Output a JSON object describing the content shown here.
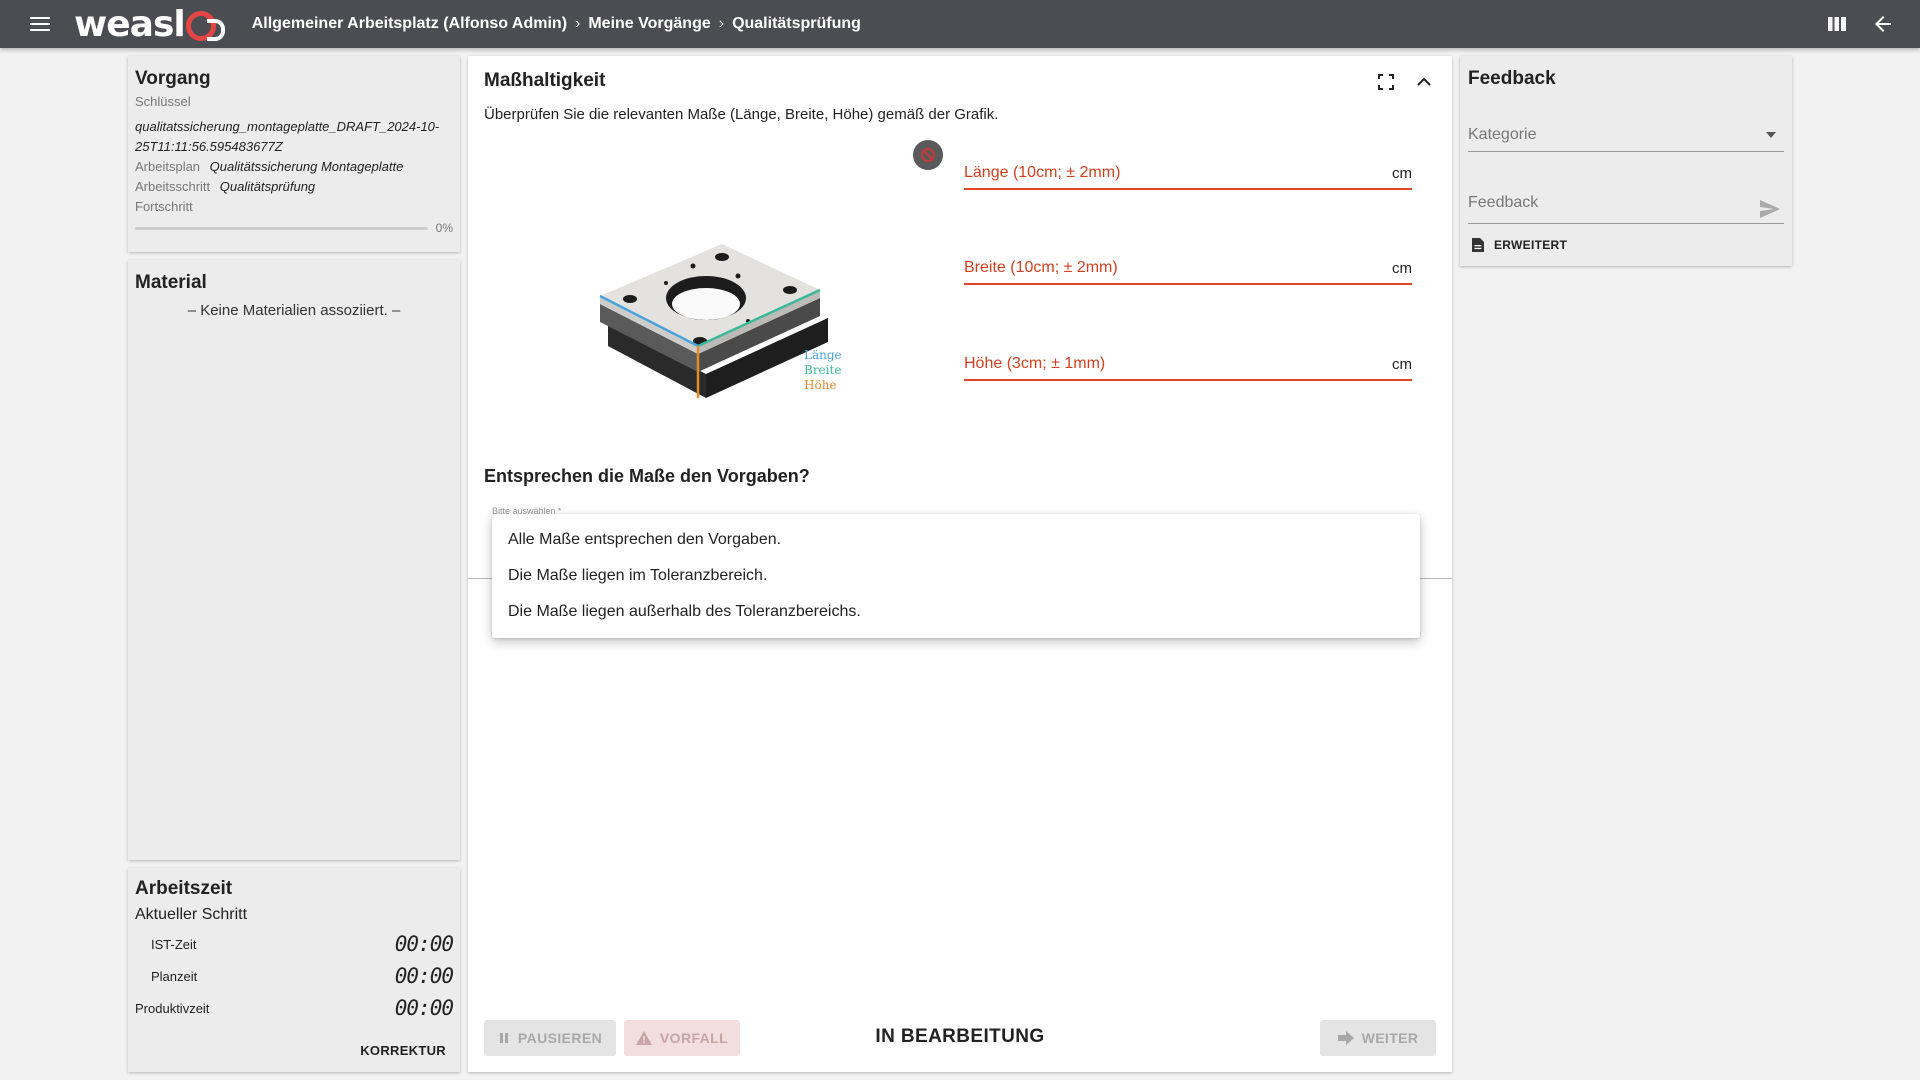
{
  "app": {
    "logo_text": "weasl",
    "breadcrumb": [
      "Allgemeiner Arbeitsplatz (Alfonso Admin)",
      "Meine Vorgänge",
      "Qualitätsprüfung"
    ],
    "breadcrumb_separator": "›"
  },
  "vorgang": {
    "title": "Vorgang",
    "key_label": "Schlüssel",
    "key_value": "qualitatssicherung_montageplatte_DRAFT_2024-10-25T11:11:56.595483677Z",
    "plan_label": "Arbeitsplan",
    "plan_value": "Qualitätssicherung Montageplatte",
    "step_label": "Arbeitsschritt",
    "step_value": "Qualitätsprüfung",
    "progress_label": "Fortschritt",
    "progress_value": 0,
    "progress_text": "0%"
  },
  "material": {
    "title": "Material",
    "empty_text": "– Keine Materialien assoziiert. –"
  },
  "arbeitszeit": {
    "title": "Arbeitszeit",
    "subtitle": "Aktueller Schritt",
    "rows": [
      {
        "label": "IST-Zeit",
        "value": "00:00"
      },
      {
        "label": "Planzeit",
        "value": "00:00"
      },
      {
        "label": "Produktivzeit",
        "value": "00:00"
      }
    ],
    "correction_label": "KORREKTUR"
  },
  "main": {
    "title": "Maßhaltigkeit",
    "instruction": "Überprüfen Sie die relevanten Maße (Länge, Breite, Höhe) gemäß der Grafik.",
    "figure_labels": [
      "Länge",
      "Breite",
      "Höhe"
    ],
    "fields": [
      {
        "label": "Länge (10cm; ± 2mm)",
        "unit": "cm"
      },
      {
        "label": "Breite (10cm; ± 2mm)",
        "unit": "cm"
      },
      {
        "label": "Höhe (3cm; ± 1mm)",
        "unit": "cm"
      }
    ],
    "question": "Entsprechen die Maße den Vorgaben?",
    "select_label": "Bitte auswählen *",
    "options": [
      "Alle Maße entsprechen den Vorgaben.",
      "Die Maße liegen im Toleranzbereich.",
      "Die Maße liegen außerhalb des Toleranzbereichs."
    ],
    "footer": {
      "pause_label": "PAUSIEREN",
      "incident_label": "VORFALL",
      "status": "IN BEARBEITUNG",
      "next_label": "WEITER"
    }
  },
  "feedback": {
    "title": "Feedback",
    "category_placeholder": "Kategorie",
    "feedback_placeholder": "Feedback",
    "extended_label": "ERWEITERT"
  },
  "colors": {
    "topbar": "#4c4c53",
    "accent_red": "#e0452b",
    "logo_red": "#e64545",
    "length_color": "#4aa3df",
    "width_color": "#3bb89a",
    "height_color": "#e68a2e"
  }
}
